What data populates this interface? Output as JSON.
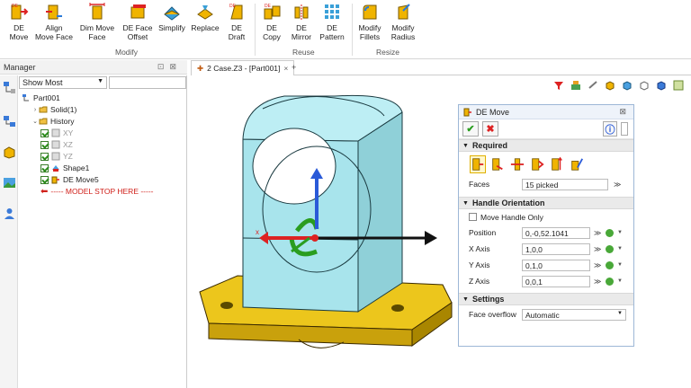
{
  "ribbon": {
    "buttons": [
      {
        "id": "de-move",
        "line1": "DE",
        "line2": "Move"
      },
      {
        "id": "align-move-face",
        "line1": "Align",
        "line2": "Move Face"
      },
      {
        "id": "dim-move-face",
        "line1": "Dim Move",
        "line2": "Face"
      },
      {
        "id": "de-face-offset",
        "line1": "DE Face",
        "line2": "Offset"
      },
      {
        "id": "simplify",
        "line1": "Simplify",
        "line2": ""
      },
      {
        "id": "replace",
        "line1": "Replace",
        "line2": ""
      },
      {
        "id": "de-draft",
        "line1": "DE",
        "line2": "Draft"
      },
      {
        "id": "de-copy",
        "line1": "DE",
        "line2": "Copy"
      },
      {
        "id": "de-mirror",
        "line1": "DE",
        "line2": "Mirror"
      },
      {
        "id": "de-pattern",
        "line1": "DE",
        "line2": "Pattern"
      },
      {
        "id": "modify-fillets",
        "line1": "Modify",
        "line2": "Fillets"
      },
      {
        "id": "modify-radius",
        "line1": "Modify",
        "line2": "Radius"
      }
    ],
    "groups": {
      "modify": "Modify",
      "reuse": "Reuse",
      "resize": "Resize"
    }
  },
  "manager": {
    "title": "Manager",
    "filter_value": "Show Most",
    "tree": {
      "part": "Part001",
      "solid": "Solid(1)",
      "history": "History",
      "xy": "XY",
      "xz": "XZ",
      "yz": "YZ",
      "shape1": "Shape1",
      "de_move5": "DE Move5",
      "stop": "----- MODEL STOP HERE -----"
    }
  },
  "tabs": {
    "doc_tab": "2  Case.Z3 - [Part001]",
    "plus": "+"
  },
  "de_move": {
    "title": "DE Move",
    "sections": {
      "required": "Required",
      "handle": "Handle Orientation",
      "settings": "Settings"
    },
    "faces_label": "Faces",
    "faces_value": "15 picked",
    "move_handle_only": "Move Handle Only",
    "position_label": "Position",
    "position_value": "0,-0,52.1041",
    "xaxis_label": "X Axis",
    "xaxis_value": "1,0,0",
    "yaxis_label": "Y Axis",
    "yaxis_value": "0,1,0",
    "zaxis_label": "Z Axis",
    "zaxis_value": "0,0,1",
    "face_overflow_label": "Face overflow",
    "face_overflow_value": "Automatic"
  },
  "colors": {
    "part_cyan": "#a8e4ec",
    "base_yellow": "#e6c21a",
    "accent_red": "#d0201a",
    "ok_green": "#2a9d1f"
  }
}
